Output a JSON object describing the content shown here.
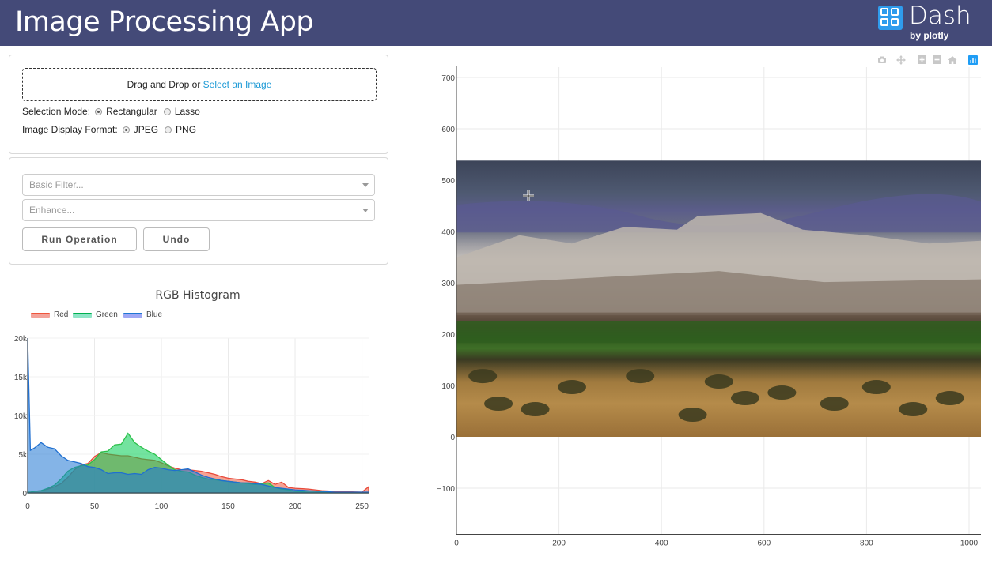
{
  "header": {
    "title": "Image Processing App",
    "logo_word": "Dash",
    "logo_by": "by plotly"
  },
  "upload": {
    "prefix": "Drag and Drop or ",
    "link": "Select an Image"
  },
  "selection_mode": {
    "label": "Selection Mode:",
    "options": [
      "Rectangular",
      "Lasso"
    ],
    "selected": "Rectangular"
  },
  "display_format": {
    "label": "Image Display Format:",
    "options": [
      "JPEG",
      "PNG"
    ],
    "selected": "JPEG"
  },
  "filter_dropdown": {
    "placeholder": "Basic Filter..."
  },
  "enhance_dropdown": {
    "placeholder": "Enhance..."
  },
  "buttons": {
    "run": "Run Operation",
    "undo": "Undo"
  },
  "modebar_icons": [
    "camera-icon",
    "pan-icon",
    "zoom-in-icon",
    "zoom-out-icon",
    "reset-axes-icon",
    "plotly-logo-icon"
  ],
  "colors": {
    "banner": "#444a78",
    "link": "#1d9ad6",
    "red": "#ef553b",
    "green": "#00cc96",
    "blue": "#636efa"
  },
  "chart_data": [
    {
      "type": "area",
      "title": "RGB Histogram",
      "legend": "top-left, horizontal",
      "xlim": [
        0,
        255
      ],
      "ylim": [
        0,
        20000
      ],
      "x_ticks": [
        "0",
        "50",
        "100",
        "150",
        "200",
        "250"
      ],
      "y_ticks": [
        "0",
        "5k",
        "10k",
        "15k",
        "20k"
      ],
      "x": [
        0,
        2,
        5,
        10,
        15,
        20,
        25,
        30,
        35,
        40,
        45,
        50,
        55,
        60,
        65,
        70,
        75,
        80,
        85,
        90,
        95,
        100,
        105,
        110,
        115,
        120,
        125,
        130,
        135,
        140,
        145,
        150,
        155,
        160,
        165,
        170,
        175,
        180,
        185,
        190,
        195,
        200,
        210,
        220,
        230,
        240,
        250,
        255
      ],
      "series": [
        {
          "name": "Red",
          "color": "#ef553b",
          "values": [
            100,
            100,
            200,
            300,
            500,
            800,
            1200,
            2000,
            3000,
            3600,
            3800,
            4700,
            5200,
            5000,
            4900,
            4800,
            4800,
            4600,
            4400,
            4300,
            4200,
            3900,
            3500,
            3200,
            3000,
            3000,
            2900,
            2800,
            2600,
            2400,
            2100,
            1900,
            1800,
            1700,
            1500,
            1400,
            1200,
            1600,
            1100,
            1400,
            700,
            600,
            500,
            300,
            200,
            150,
            100,
            800
          ]
        },
        {
          "name": "Green",
          "color": "#00cc96",
          "values": [
            100,
            100,
            200,
            300,
            600,
            1000,
            1800,
            2800,
            3300,
            3500,
            3600,
            4300,
            5300,
            5400,
            6200,
            6300,
            7700,
            6500,
            5900,
            5400,
            5000,
            4300,
            3600,
            3000,
            2800,
            2700,
            2300,
            2000,
            1800,
            1700,
            1600,
            1500,
            1400,
            1300,
            1200,
            1100,
            1200,
            1300,
            700,
            500,
            400,
            200,
            100,
            100,
            0,
            0,
            0,
            100
          ]
        },
        {
          "name": "Blue",
          "color": "#636efa",
          "values": [
            20000,
            5500,
            5800,
            6500,
            5900,
            5700,
            4800,
            4200,
            4000,
            3800,
            3400,
            3300,
            3000,
            2500,
            2600,
            2600,
            2400,
            2500,
            2400,
            3000,
            3300,
            3200,
            3000,
            2900,
            3000,
            3100,
            2700,
            2300,
            2000,
            1800,
            1600,
            1500,
            1400,
            1300,
            1300,
            1200,
            1100,
            900,
            700,
            600,
            500,
            400,
            300,
            200,
            100,
            100,
            100,
            100
          ]
        }
      ]
    },
    {
      "type": "heatmap",
      "title": "",
      "xlim": [
        0,
        1024
      ],
      "ylim": [
        -190,
        720
      ],
      "x_ticks": [
        "0",
        "200",
        "400",
        "600",
        "800",
        "1000"
      ],
      "y_ticks": [
        "−100",
        "0",
        "100",
        "200",
        "300",
        "400",
        "500",
        "600",
        "700"
      ],
      "image_extent": {
        "x": [
          0,
          1024
        ],
        "y": [
          0,
          538
        ]
      },
      "grid": true
    }
  ]
}
